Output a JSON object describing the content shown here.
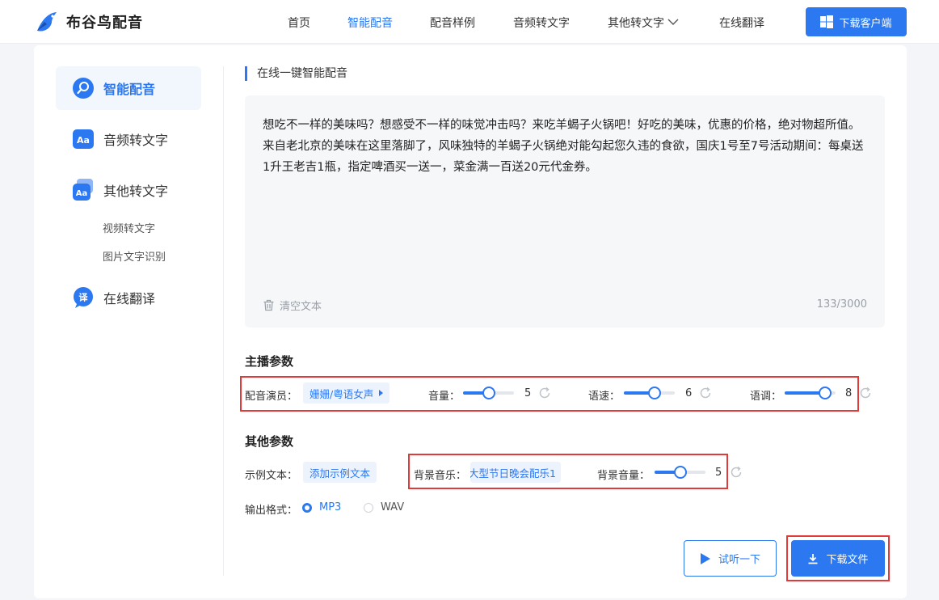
{
  "brand": {
    "name": "布谷鸟配音"
  },
  "nav": {
    "items": [
      "首页",
      "智能配音",
      "配音样例",
      "音频转文字",
      "其他转文字",
      "在线翻译"
    ],
    "active": "智能配音",
    "download_client": "下载客户端"
  },
  "sidebar": {
    "items": [
      {
        "label": "智能配音",
        "active": true
      },
      {
        "label": "音频转文字"
      },
      {
        "label": "其他转文字"
      },
      {
        "label": "在线翻译"
      }
    ],
    "sub_items": [
      "视频转文字",
      "图片文字识别"
    ]
  },
  "editor": {
    "section_title": "在线一键智能配音",
    "text": "想吃不一样的美味吗？想感受不一样的味觉冲击吗？来吃羊蝎子火锅吧！好吃的美味，优惠的价格，绝对物超所值。来自老北京的美味在这里落脚了，风味独特的羊蝎子火锅绝对能勾起您久违的食欲，国庆1号至7号活动期间：每桌送1升王老吉1瓶，指定啤酒买一送一，菜金满一百送20元代金券。",
    "clear_label": "清空文本",
    "char_count": "133/3000"
  },
  "anchor_params": {
    "title": "主播参数",
    "voice_label": "配音演员：",
    "voice_value": "姗姗/粤语女声",
    "volume": {
      "label": "音量：",
      "value": 5,
      "max": 10
    },
    "speed": {
      "label": "语速：",
      "value": 6,
      "max": 10
    },
    "pitch": {
      "label": "语调：",
      "value": 8,
      "max": 10
    }
  },
  "other_params": {
    "title": "其他参数",
    "sample_label": "示例文本：",
    "sample_button": "添加示例文本",
    "bgm_label": "背景音乐：",
    "bgm_value": "大型节日晚会配乐1",
    "bgm_volume": {
      "label": "背景音量：",
      "value": 5,
      "max": 10
    },
    "format_label": "输出格式：",
    "formats": [
      "MP3",
      "WAV"
    ],
    "selected_format": "MP3"
  },
  "actions": {
    "preview": "试听一下",
    "download": "下载文件"
  },
  "colors": {
    "accent": "#2b78f0",
    "highlight": "#e03a3a"
  }
}
